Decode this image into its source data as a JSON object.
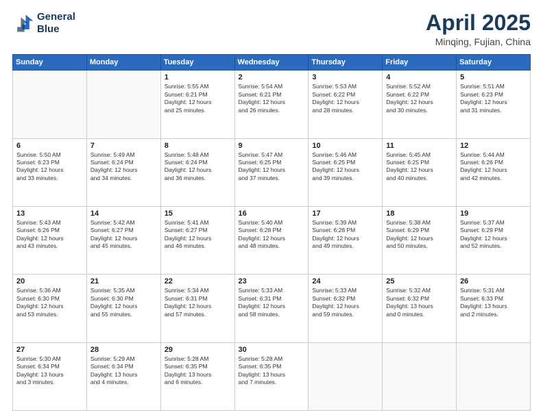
{
  "header": {
    "logo_line1": "General",
    "logo_line2": "Blue",
    "month": "April 2025",
    "location": "Minqing, Fujian, China"
  },
  "days_of_week": [
    "Sunday",
    "Monday",
    "Tuesday",
    "Wednesday",
    "Thursday",
    "Friday",
    "Saturday"
  ],
  "weeks": [
    [
      {
        "day": "",
        "info": ""
      },
      {
        "day": "",
        "info": ""
      },
      {
        "day": "1",
        "info": "Sunrise: 5:55 AM\nSunset: 6:21 PM\nDaylight: 12 hours\nand 25 minutes."
      },
      {
        "day": "2",
        "info": "Sunrise: 5:54 AM\nSunset: 6:21 PM\nDaylight: 12 hours\nand 26 minutes."
      },
      {
        "day": "3",
        "info": "Sunrise: 5:53 AM\nSunset: 6:22 PM\nDaylight: 12 hours\nand 28 minutes."
      },
      {
        "day": "4",
        "info": "Sunrise: 5:52 AM\nSunset: 6:22 PM\nDaylight: 12 hours\nand 30 minutes."
      },
      {
        "day": "5",
        "info": "Sunrise: 5:51 AM\nSunset: 6:23 PM\nDaylight: 12 hours\nand 31 minutes."
      }
    ],
    [
      {
        "day": "6",
        "info": "Sunrise: 5:50 AM\nSunset: 6:23 PM\nDaylight: 12 hours\nand 33 minutes."
      },
      {
        "day": "7",
        "info": "Sunrise: 5:49 AM\nSunset: 6:24 PM\nDaylight: 12 hours\nand 34 minutes."
      },
      {
        "day": "8",
        "info": "Sunrise: 5:48 AM\nSunset: 6:24 PM\nDaylight: 12 hours\nand 36 minutes."
      },
      {
        "day": "9",
        "info": "Sunrise: 5:47 AM\nSunset: 6:25 PM\nDaylight: 12 hours\nand 37 minutes."
      },
      {
        "day": "10",
        "info": "Sunrise: 5:46 AM\nSunset: 6:25 PM\nDaylight: 12 hours\nand 39 minutes."
      },
      {
        "day": "11",
        "info": "Sunrise: 5:45 AM\nSunset: 6:25 PM\nDaylight: 12 hours\nand 40 minutes."
      },
      {
        "day": "12",
        "info": "Sunrise: 5:44 AM\nSunset: 6:26 PM\nDaylight: 12 hours\nand 42 minutes."
      }
    ],
    [
      {
        "day": "13",
        "info": "Sunrise: 5:43 AM\nSunset: 6:26 PM\nDaylight: 12 hours\nand 43 minutes."
      },
      {
        "day": "14",
        "info": "Sunrise: 5:42 AM\nSunset: 6:27 PM\nDaylight: 12 hours\nand 45 minutes."
      },
      {
        "day": "15",
        "info": "Sunrise: 5:41 AM\nSunset: 6:27 PM\nDaylight: 12 hours\nand 46 minutes."
      },
      {
        "day": "16",
        "info": "Sunrise: 5:40 AM\nSunset: 6:28 PM\nDaylight: 12 hours\nand 48 minutes."
      },
      {
        "day": "17",
        "info": "Sunrise: 5:39 AM\nSunset: 6:28 PM\nDaylight: 12 hours\nand 49 minutes."
      },
      {
        "day": "18",
        "info": "Sunrise: 5:38 AM\nSunset: 6:29 PM\nDaylight: 12 hours\nand 50 minutes."
      },
      {
        "day": "19",
        "info": "Sunrise: 5:37 AM\nSunset: 6:29 PM\nDaylight: 12 hours\nand 52 minutes."
      }
    ],
    [
      {
        "day": "20",
        "info": "Sunrise: 5:36 AM\nSunset: 6:30 PM\nDaylight: 12 hours\nand 53 minutes."
      },
      {
        "day": "21",
        "info": "Sunrise: 5:35 AM\nSunset: 6:30 PM\nDaylight: 12 hours\nand 55 minutes."
      },
      {
        "day": "22",
        "info": "Sunrise: 5:34 AM\nSunset: 6:31 PM\nDaylight: 12 hours\nand 57 minutes."
      },
      {
        "day": "23",
        "info": "Sunrise: 5:33 AM\nSunset: 6:31 PM\nDaylight: 12 hours\nand 58 minutes."
      },
      {
        "day": "24",
        "info": "Sunrise: 5:33 AM\nSunset: 6:32 PM\nDaylight: 12 hours\nand 59 minutes."
      },
      {
        "day": "25",
        "info": "Sunrise: 5:32 AM\nSunset: 6:32 PM\nDaylight: 13 hours\nand 0 minutes."
      },
      {
        "day": "26",
        "info": "Sunrise: 5:31 AM\nSunset: 6:33 PM\nDaylight: 13 hours\nand 2 minutes."
      }
    ],
    [
      {
        "day": "27",
        "info": "Sunrise: 5:30 AM\nSunset: 6:34 PM\nDaylight: 13 hours\nand 3 minutes."
      },
      {
        "day": "28",
        "info": "Sunrise: 5:29 AM\nSunset: 6:34 PM\nDaylight: 13 hours\nand 4 minutes."
      },
      {
        "day": "29",
        "info": "Sunrise: 5:28 AM\nSunset: 6:35 PM\nDaylight: 13 hours\nand 6 minutes."
      },
      {
        "day": "30",
        "info": "Sunrise: 5:28 AM\nSunset: 6:35 PM\nDaylight: 13 hours\nand 7 minutes."
      },
      {
        "day": "",
        "info": ""
      },
      {
        "day": "",
        "info": ""
      },
      {
        "day": "",
        "info": ""
      }
    ]
  ]
}
